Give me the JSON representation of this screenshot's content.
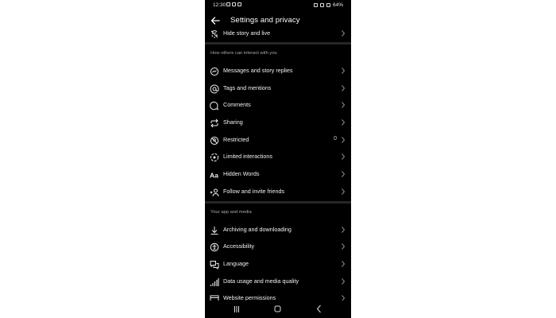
{
  "status_bar": {
    "time": "12:30",
    "battery": "64%"
  },
  "header": {
    "title": "Settings and privacy"
  },
  "top_item": {
    "label": "Hide story and live",
    "icon": "hide-story-icon"
  },
  "sections": [
    {
      "title": "How others can interact with you",
      "items": [
        {
          "label": "Messages and story replies",
          "icon": "messenger-icon"
        },
        {
          "label": "Tags and mentions",
          "icon": "at-icon"
        },
        {
          "label": "Comments",
          "icon": "comment-icon"
        },
        {
          "label": "Sharing",
          "icon": "repost-icon"
        },
        {
          "label": "Restricted",
          "icon": "restricted-icon",
          "count": "0"
        },
        {
          "label": "Limited interactions",
          "icon": "limited-icon"
        },
        {
          "label": "Hidden Words",
          "icon": "text-aa-icon"
        },
        {
          "label": "Follow and invite friends",
          "icon": "add-person-icon"
        }
      ]
    },
    {
      "title": "Your app and media",
      "items": [
        {
          "label": "Archiving and downloading",
          "icon": "download-icon"
        },
        {
          "label": "Accessibility",
          "icon": "accessibility-icon"
        },
        {
          "label": "Language",
          "icon": "language-icon"
        },
        {
          "label": "Data usage and media quality",
          "icon": "signal-bars-icon"
        },
        {
          "label": "Website permissions",
          "icon": "website-icon"
        }
      ]
    }
  ],
  "colors": {
    "background": "#000000",
    "text": "#f0f0f0",
    "section_title": "#a8a8a8",
    "divider": "#262626"
  }
}
